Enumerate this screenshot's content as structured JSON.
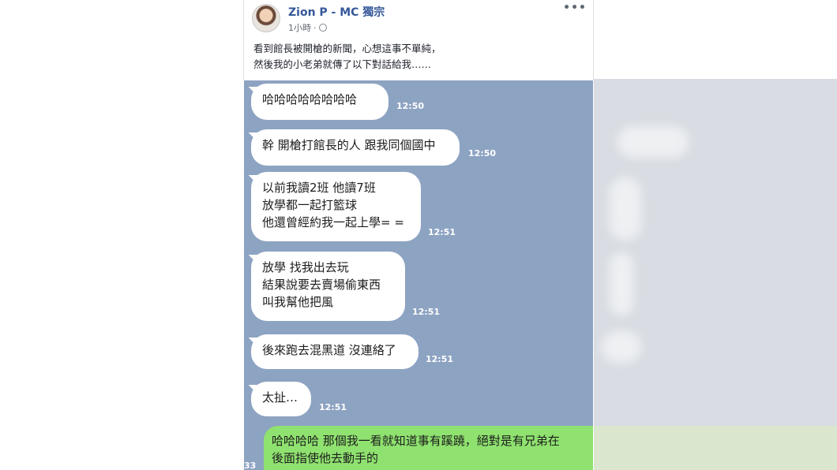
{
  "post": {
    "author": "Zion P - MC 獨宗",
    "time": "1小時",
    "more": "•••",
    "caption_lines": [
      "看到館長被開槍的新聞，心想這事不單純，",
      "然後我的小老弟就傳了以下對話給我……"
    ]
  },
  "chat": {
    "messages": [
      {
        "lines": [
          "哈哈哈哈哈哈哈哈"
        ],
        "time": "12:50"
      },
      {
        "lines": [
          "幹 開槍打館長的人 跟我同個國中"
        ],
        "time": "12:50"
      },
      {
        "lines": [
          "以前我讀2班 他讀7班",
          "放學都一起打籃球",
          "他還曾經約我一起上學= ="
        ],
        "time": "12:51"
      },
      {
        "lines": [
          "放學 找我出去玩",
          "結果說要去賣場偷東西",
          "叫我幫他把風"
        ],
        "time": "12:51"
      },
      {
        "lines": [
          "後來跑去混黑道 沒連絡了"
        ],
        "time": "12:51"
      },
      {
        "lines": [
          "太扯…"
        ],
        "time": "12:51"
      }
    ],
    "reply": {
      "lines": [
        "哈哈哈哈 那個我一看就知道事有蹊蹺，絕對是有兄弟在",
        "後面指使他去動手的"
      ],
      "time_partial": "33"
    }
  },
  "colors": {
    "chat_background": "#8da3c2",
    "incoming_bubble": "#ffffff",
    "outgoing_bubble": "#8fe26f",
    "author_link": "#365899"
  }
}
